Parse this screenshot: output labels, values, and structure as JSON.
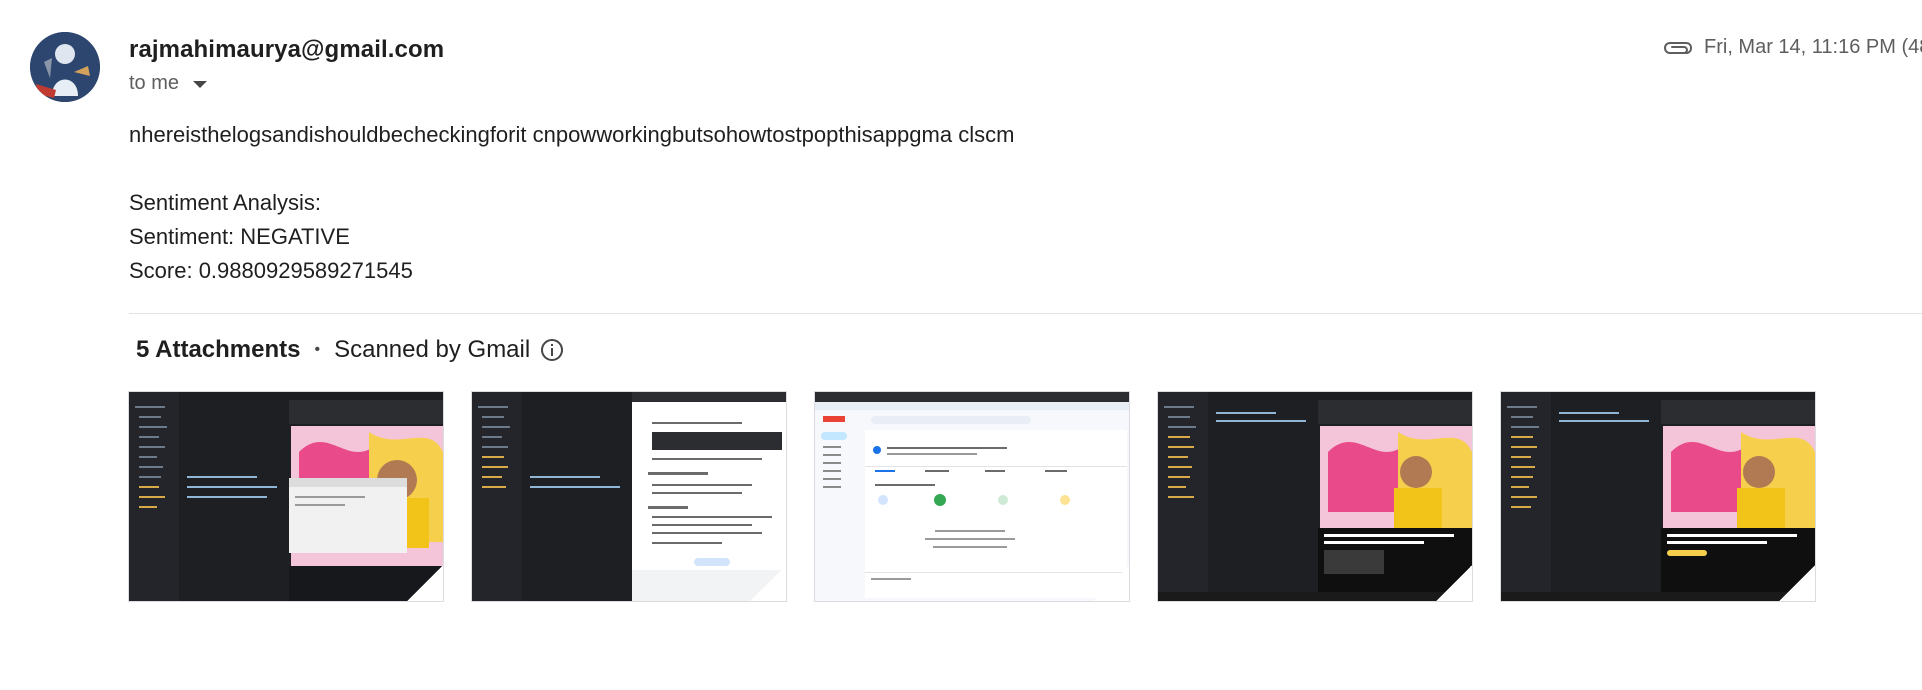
{
  "email": {
    "sender": "rajmahimaurya@gmail.com",
    "recipient_label": "to me",
    "timestamp": "Fri, Mar 14, 11:16 PM (48",
    "body_lines": [
      "nhereisthelogsandishouldbecheckingforit cnpowworkingbutsohowtostpopthisappgma clscm",
      "",
      "Sentiment Analysis:",
      "Sentiment: NEGATIVE",
      "Score: 0.9880929589271545"
    ]
  },
  "attachments": {
    "count_label": "5 Attachments",
    "separator": "•",
    "scan_label": "Scanned by Gmail",
    "items": [
      {
        "kind": "screenshot-code-editor-video"
      },
      {
        "kind": "screenshot-code-editor-docs"
      },
      {
        "kind": "screenshot-gmail-inbox"
      },
      {
        "kind": "screenshot-code-editor-video"
      },
      {
        "kind": "screenshot-code-editor-video"
      }
    ]
  },
  "icons": {
    "attachment": "paperclip-icon",
    "info": "info-icon",
    "caret": "chevron-down-icon"
  },
  "colors": {
    "text_primary": "#1f1f1f",
    "text_secondary": "#5e5e5e",
    "divider": "#e3e3e3"
  }
}
